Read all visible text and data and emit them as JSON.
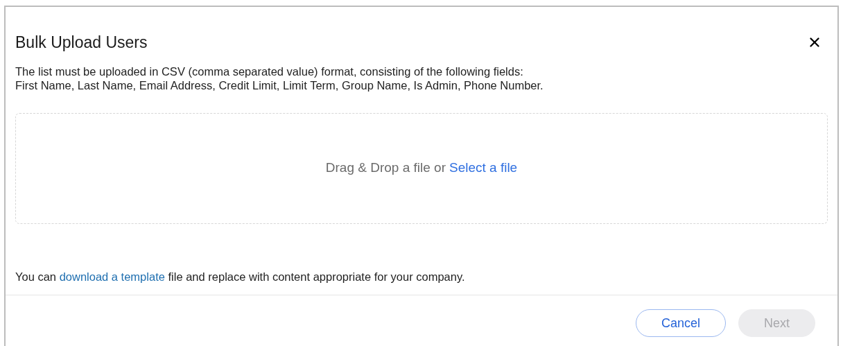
{
  "dialog": {
    "title": "Bulk Upload Users",
    "description_lines": [
      "The list must be uploaded in CSV (comma separated value) format, consisting of the following fields:",
      "First Name, Last Name, Email Address, Credit Limit, Limit Term, Group Name, Is Admin, Phone Number."
    ],
    "dropzone": {
      "text": "Drag & Drop a file or",
      "link": "Select a file"
    },
    "template_note": {
      "before": "You can",
      "link": "download a template",
      "after": "file and replace with content appropriate for your company."
    },
    "buttons": [
      {
        "kind": "secondary",
        "label": "Cancel",
        "disabled": false
      },
      {
        "kind": "primary",
        "label": "Next",
        "disabled": true
      }
    ]
  }
}
